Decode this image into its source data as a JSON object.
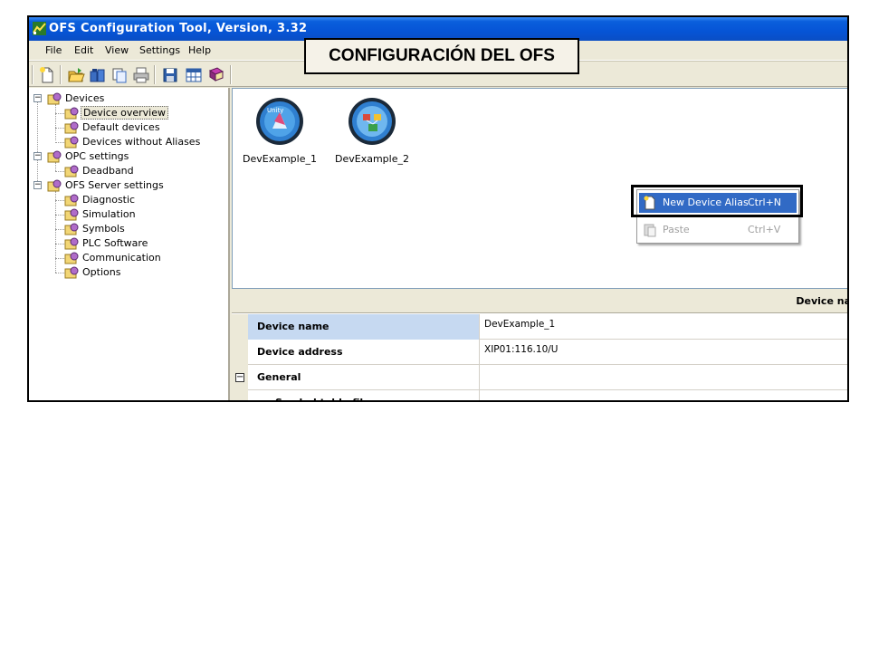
{
  "window": {
    "title": "OFS Configuration Tool,  Version, 3.32"
  },
  "menu": [
    "File",
    "Edit",
    "View",
    "Settings",
    "Help"
  ],
  "caption": "CONFIGURACIÓN  DEL OFS",
  "toolbar": {
    "buttons": [
      "new-icon",
      "open-icon",
      "devices-icon",
      "copy-icon",
      "print-icon",
      "save-icon",
      "table-icon",
      "book-icon"
    ]
  },
  "tree": {
    "devices": "Devices",
    "device_overview": "Device overview",
    "default_devices": "Default devices",
    "devices_without_aliases": "Devices without Aliases",
    "opc_settings": "OPC settings",
    "deadband": "Deadband",
    "ofs_server_settings": "OFS Server settings",
    "diagnostic": "Diagnostic",
    "simulation": "Simulation",
    "symbols": "Symbols",
    "plc_software": "PLC Software",
    "communication": "Communication",
    "options": "Options"
  },
  "overview": {
    "device1": "DevExample_1",
    "device1_badge": "Unity",
    "device2": "DevExample_2"
  },
  "context_menu": {
    "new_alias": "New Device Alias",
    "new_alias_shortcut": "Ctrl+N",
    "paste": "Paste",
    "paste_shortcut": "Ctrl+V"
  },
  "properties": {
    "header": "Device na",
    "rows": [
      {
        "name": "Device name",
        "value": "DevExample_1"
      },
      {
        "name": "Device address",
        "value": "XIP01:116.10/U"
      },
      {
        "name": "General",
        "value": ""
      },
      {
        "name": "Symbol table file",
        "value": ""
      }
    ],
    "group_toggle": "⊟"
  },
  "colors": {
    "titlebar": "#0654d6",
    "selection": "#316ac5",
    "property_highlight": "#c6d9f1"
  }
}
